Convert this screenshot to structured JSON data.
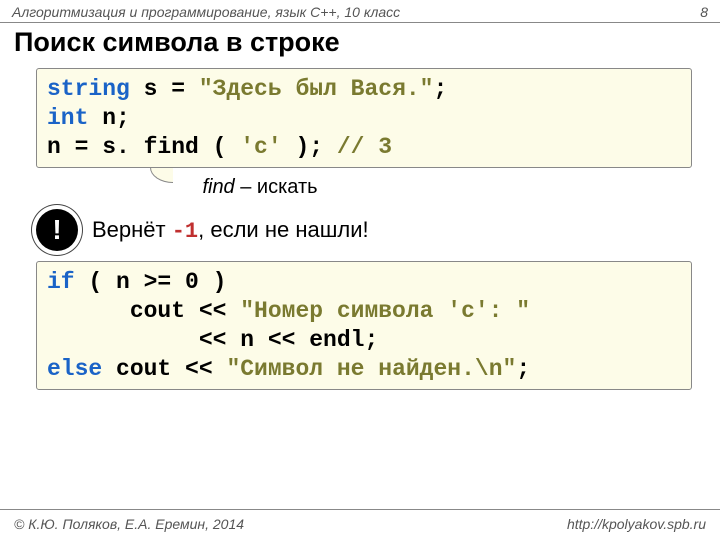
{
  "header": {
    "subject": "Алгоритмизация и программирование, язык C++, 10 класс",
    "page": "8"
  },
  "title": "Поиск символа в строке",
  "code1": {
    "l1_type": "string",
    "l1_rest": " s = ",
    "l1_str": "\"Здесь был Вася.\"",
    "l1_end": ";",
    "l2_type": "int",
    "l2_rest": " n;",
    "l3_lhs": "n = s. find ( ",
    "l3_arg": "'с'",
    "l3_mid": " );   ",
    "l3_comment": "// 3"
  },
  "caption": {
    "word": "find",
    "rest": " – искать"
  },
  "warn": {
    "pre": "Вернёт ",
    "val": "-1",
    "post": ", если не нашли!"
  },
  "code2": {
    "l1_if": "if",
    "l1_rest": " ( n >= 0 )",
    "l2_pad": "      cout << ",
    "l2_str": "\"Номер символа 'c': \"",
    "l3_pad": "           << n << endl;",
    "l4_else": "else",
    "l4_rest": " cout << ",
    "l4_str": "\"Символ не найден.\\n\"",
    "l4_end": ";"
  },
  "footer": {
    "left": "© К.Ю. Поляков, Е.А. Еремин, 2014",
    "right": "http://kpolyakov.spb.ru"
  },
  "marks": {
    "excl": "!"
  }
}
